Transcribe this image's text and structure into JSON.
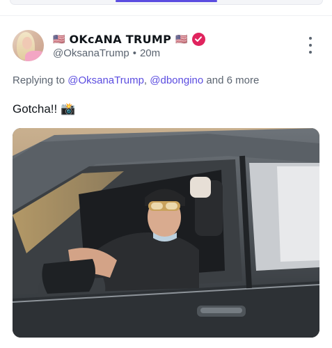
{
  "post": {
    "flag_left": "🇺🇸",
    "display_name": "OKсANA TRUMP",
    "flag_right": "🇺🇸",
    "handle": "@OksanaTrump",
    "separator": "•",
    "time": "20m",
    "replying_prefix": "Replying to",
    "mention_1": "@OksanaTrump",
    "comma": ",",
    "mention_2": "@dbongino",
    "replying_suffix": "and 6 more",
    "text": "Gotcha!! 📸"
  },
  "colors": {
    "accent": "#5b4ce0",
    "verified_badge": "#e0245e",
    "secondary_text": "#5b6470"
  },
  "icons": {
    "verified": "verified-badge-icon",
    "more": "more-vertical-icon"
  }
}
